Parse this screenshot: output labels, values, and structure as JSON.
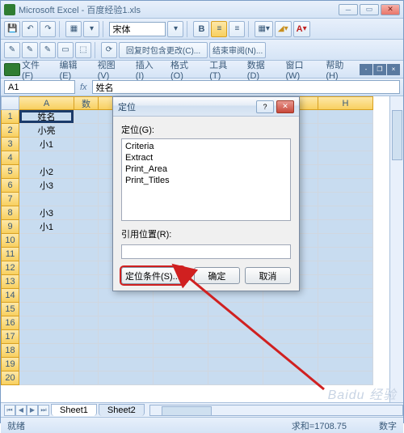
{
  "title": "Microsoft Excel - 百度经验1.xls",
  "font_name": "宋体",
  "menubar": [
    "文件(F)",
    "编辑(E)",
    "视图(V)",
    "插入(I)",
    "格式(O)",
    "工具(T)",
    "数据(D)",
    "窗口(W)",
    "帮助(H)"
  ],
  "toolbar2": {
    "msg1": "回复时包含更改(C)...",
    "msg2": "结束审阅(N)..."
  },
  "namebox": {
    "ref": "A1",
    "value": "姓名"
  },
  "columns": [
    "A",
    "数",
    "",
    "",
    "",
    "",
    "H"
  ],
  "rows": [
    "1",
    "2",
    "3",
    "4",
    "5",
    "6",
    "7",
    "8",
    "9",
    "10",
    "11",
    "12",
    "13",
    "14",
    "15",
    "16",
    "17",
    "18",
    "19",
    "20"
  ],
  "colA": [
    "姓名",
    "小亮",
    "小1",
    "",
    "小2",
    "小3",
    "",
    "小3",
    "小1",
    "",
    "",
    "",
    "",
    "",
    "",
    "",
    "",
    "",
    "",
    ""
  ],
  "sheets": [
    "Sheet1",
    "Sheet2"
  ],
  "status": {
    "ready": "就绪",
    "sum_label": "求和=1708.75",
    "mode": "数字"
  },
  "dialog": {
    "title": "定位",
    "goto_label": "定位(G):",
    "list": [
      "Criteria",
      "Extract",
      "Print_Area",
      "Print_Titles"
    ],
    "ref_label": "引用位置(R):",
    "ref_value": "",
    "btn_special": "定位条件(S)...",
    "btn_ok": "确定",
    "btn_cancel": "取消"
  },
  "watermark": "Baidu 经验"
}
